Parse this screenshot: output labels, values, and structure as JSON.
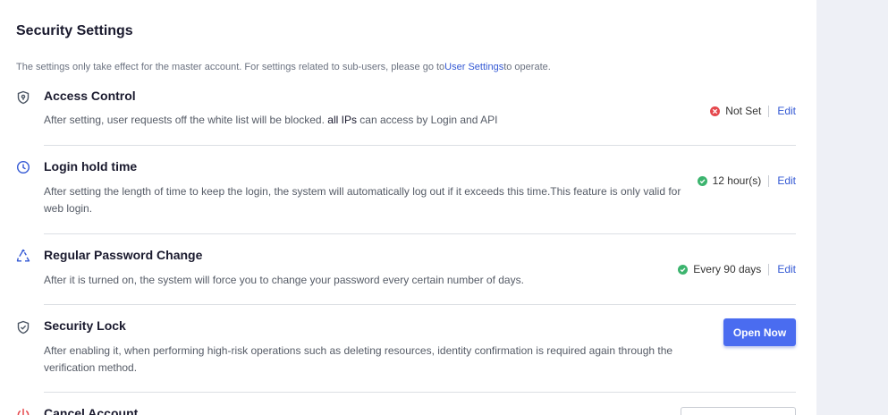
{
  "page": {
    "title": "Security Settings",
    "notice_prefix": "The settings only take effect for the master account. For settings related to sub-users, please go to",
    "notice_link": "User Settings",
    "notice_suffix": "to operate."
  },
  "settings": [
    {
      "icon": "shield-pin-icon",
      "title": "Access Control",
      "desc_prefix": "After setting, user requests off the white list will be blocked. ",
      "desc_highlight": "all IPs",
      "desc_suffix": " can access by Login and API",
      "status": "Not Set",
      "status_color": "#e5484d",
      "edit_label": "Edit"
    },
    {
      "icon": "clock-icon",
      "title": "Login hold time",
      "desc": "After setting the length of time to keep the login, the system will automatically log out if it exceeds this time.This feature is only valid for web login.",
      "status": "12 hour(s)",
      "status_color": "#3cb46e",
      "edit_label": "Edit"
    },
    {
      "icon": "recycle-icon",
      "title": "Regular Password Change",
      "desc": "After it is turned on, the system will force you to change your password every certain number of days.",
      "status": "Every 90 days",
      "status_color": "#3cb46e",
      "edit_label": "Edit"
    },
    {
      "icon": "shield-check-icon",
      "title": "Security Lock",
      "desc": "After enabling it, when performing high-risk operations such as deleting resources, identity confirmation is required again through the verification method.",
      "button_label": "Open Now"
    },
    {
      "icon": "power-icon",
      "title": "Cancel Account"
    }
  ],
  "colors": {
    "accent": "#4a6cf0",
    "link": "#3358d4",
    "success": "#3cb46e",
    "error": "#e5484d",
    "danger_icon": "#e5484d"
  }
}
